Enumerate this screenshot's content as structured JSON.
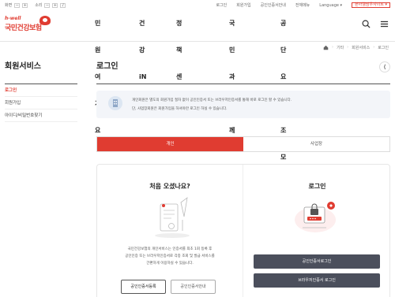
{
  "util": {
    "zoom_label": "화면",
    "zoom_out": "−",
    "zoom_in": "+",
    "sound_label": "소리",
    "links": [
      "로그인",
      "회원가입",
      "공인인증서안내",
      "전체메뉴",
      "Language"
    ],
    "other_sites": "본아웰맘우사이트"
  },
  "logo": {
    "tagline": "h-well",
    "name": "국민건강보험"
  },
  "gnb": [
    "민원여기요",
    "건강iN",
    "정책센터",
    "국민과함께",
    "공단요모조모"
  ],
  "breadcrumb": [
    "기타",
    "회원서비스",
    "로그인"
  ],
  "side": {
    "title": "회원서비스",
    "items": [
      "로그인",
      "회원가입",
      "아이디/비밀번호찾기"
    ]
  },
  "main": {
    "title": "로그인",
    "notice": {
      "line1": "개인회원은 별도의 회원가입 절차 없이 공인인증서 또는 브라우저인증서를 통해 바로 로그인 할 수 있습니다.",
      "line2": "단, 사업장회원은 회원가입을 하셔야만 로그인 하실 수 있습니다."
    },
    "tabs": [
      "개인",
      "사업장"
    ],
    "left": {
      "title": "처음 오셨나요?",
      "desc": [
        "국민건강보험의 개인서비스는 인증서를 최초 1회 등록 후",
        "공인인증 또는 브라우저인증서로 각종 조회 및 발급 서비스를",
        "간편하게 이용하실 수 있습니다."
      ],
      "btn_register": "공인인증서등록",
      "btn_guide": "공인인증서안내"
    },
    "right": {
      "title": "로그인",
      "btn_cert_login": "공인인증서로그인",
      "btn_browser_login": "브라우저인증서 로그인"
    }
  },
  "colors": {
    "accent": "#e03c31",
    "dark_button": "#4b4f5c",
    "notice_bg": "#f3f5f9"
  }
}
